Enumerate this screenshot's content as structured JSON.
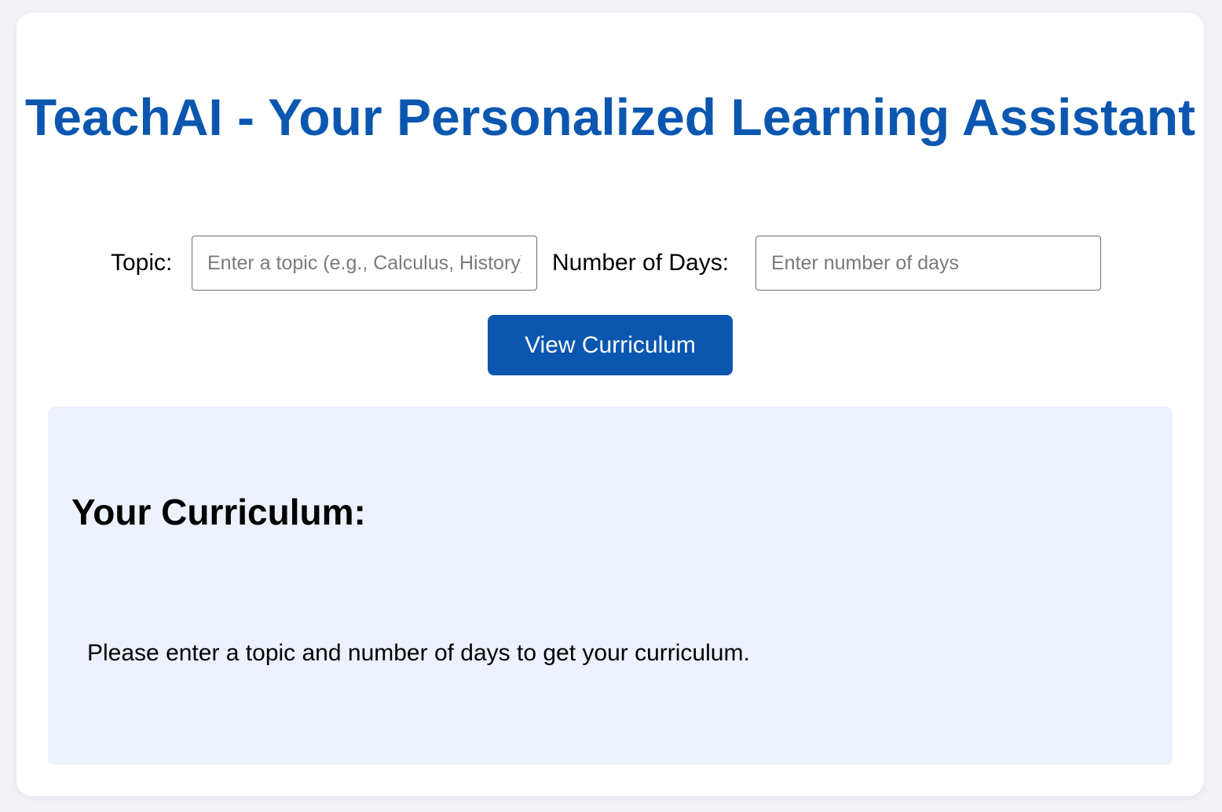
{
  "app": {
    "title": "TeachAI - Your Personalized Learning Assistant"
  },
  "form": {
    "topic_label": "Topic:",
    "topic_placeholder": "Enter a topic (e.g., Calculus, History)",
    "topic_value": "",
    "days_label": "Number of Days:",
    "days_placeholder": "Enter number of days",
    "days_value": "",
    "submit_label": "View Curriculum"
  },
  "curriculum": {
    "heading": "Your Curriculum:",
    "message": "Please enter a topic and number of days to get your curriculum."
  },
  "colors": {
    "accent": "#0b57b0",
    "panel_background": "#edf0fd",
    "page_background": "#f1f1f6"
  }
}
